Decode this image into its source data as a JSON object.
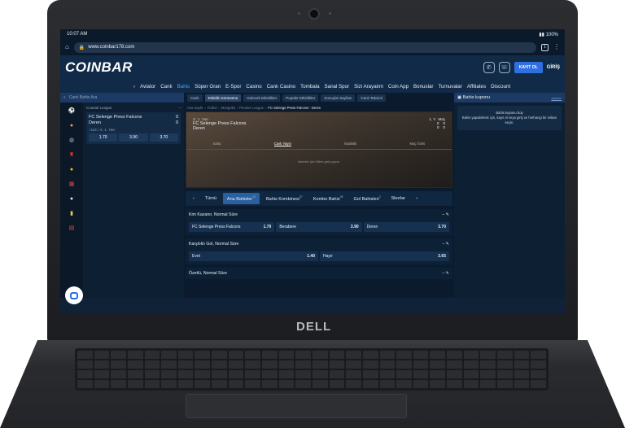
{
  "status": {
    "time": "10:07 AM",
    "battery": "100%"
  },
  "browser": {
    "url": "www.coinbar178.com",
    "tab_count": "1"
  },
  "header": {
    "logo": "COINBAR",
    "register_label": "KAYIT OL",
    "login_label": "GİRİŞ"
  },
  "nav": {
    "items": [
      "Aviator",
      "Canlı",
      "Bahis",
      "Süper Oran",
      "E-Spor",
      "Casino",
      "Canlı Casino",
      "Tombala",
      "Sanal Spor",
      "Sizi Arayalım",
      "Coin App",
      "Bonuslar",
      "Turnuvalar",
      "Affiliates",
      "Discount"
    ],
    "active_index": 2
  },
  "left": {
    "search_placeholder": "Canlı Bahis Ara",
    "league": "Coastal League",
    "match": {
      "home": "FC Selenge Press Falcons",
      "away": "Deren",
      "home_score": "0",
      "away_score": "0",
      "meta": "+114 / 4', 1. Yarı",
      "odds": [
        "1.70",
        "3.90",
        "3.70"
      ]
    }
  },
  "center": {
    "subtabs": [
      "Canlı",
      "Etkinlik Görünümü",
      "Gelecek Etkinlikler",
      "Popüler Etkinlikler",
      "Sonuçlar Sayfası",
      "Canlı Takvimi"
    ],
    "active_subtab": 1,
    "breadcrumb": [
      "Ana Sayfa",
      "Futbol",
      "Mongolia",
      "Premier League"
    ],
    "breadcrumb_current": "FC Selenge Press Falcons - Deren",
    "stage": {
      "time": "4', 1. Yarı",
      "home": "FC Selenge Press Falcons",
      "away": "Deren",
      "col1": "1. Y.",
      "col2": "Maç",
      "h1": "0",
      "h2": "0",
      "a1": "0",
      "a2": "0",
      "tabs": [
        "Saha",
        "Canlı Yayın",
        "İstatistik",
        "Maç Özeti"
      ],
      "active_tab": 1,
      "message": "İzlemek için lütfen giriş yapın."
    },
    "market_tabs": [
      {
        "label": "Tümü",
        "count": ""
      },
      {
        "label": "Ana Bahisler",
        "count": "15"
      },
      {
        "label": "Bahis Kombinesi",
        "count": "37"
      },
      {
        "label": "Kombo Bahis",
        "count": "28"
      },
      {
        "label": "Gol Bahisleri",
        "count": "2"
      },
      {
        "label": "Skorlar",
        "count": ""
      }
    ],
    "market_active": 1,
    "markets": [
      {
        "title": "Kim Kazanır, Normal Süre",
        "selections": [
          {
            "name": "FC Selenge Press Falcons",
            "odd": "1.70"
          },
          {
            "name": "Berabere",
            "odd": "3.90"
          },
          {
            "name": "Deren",
            "odd": "3.70"
          }
        ]
      },
      {
        "title": "Karşılıklı Gol, Normal Süre",
        "selections": [
          {
            "name": "Evet",
            "odd": "1.40"
          },
          {
            "name": "Hayır",
            "odd": "2.65"
          }
        ]
      },
      {
        "title": "Özetlü, Normal Süre",
        "selections": []
      }
    ]
  },
  "coupon": {
    "title": "Bahis kuponu",
    "settings": "Ayarlar",
    "empty_title": "Bahis kuponu boş",
    "empty_text": "Bahis yapabilmek için, kayıt ol veya giriş ve herhangi bir miktar seçin."
  },
  "device": {
    "brand": "DELL"
  }
}
